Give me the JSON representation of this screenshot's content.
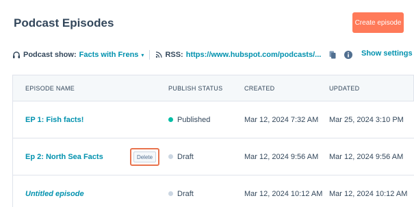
{
  "page_title": "Podcast Episodes",
  "create_button": "Create episode",
  "show_bar": {
    "show_label": "Podcast show:",
    "show_value": "Facts with Frens",
    "rss_label": "RSS:",
    "rss_url": "https://www.hubspot.com/podcasts/...",
    "show_settings": "Show settings"
  },
  "table": {
    "headers": [
      "EPISODE NAME",
      "PUBLISH STATUS",
      "CREATED",
      "UPDATED"
    ],
    "rows": [
      {
        "name": "EP 1: Fish facts!",
        "status": "Published",
        "created": "Mar 12, 2024 7:32 AM",
        "updated": "Mar 25, 2024 3:10 PM"
      },
      {
        "name": "Ep 2: North Sea Facts",
        "status": "Draft",
        "created": "Mar 12, 2024 9:56 AM",
        "updated": "Mar 12, 2024 9:56 AM",
        "action": "Delete"
      },
      {
        "name": "Untitled episode",
        "status": "Draft",
        "created": "Mar 12, 2024 10:12 AM",
        "updated": "Mar 12, 2024 10:12 AM"
      }
    ]
  },
  "colors": {
    "accent": "#ff7a59",
    "link": "#0091ae",
    "published": "#00bda5",
    "draft": "#cbd6e2",
    "highlight": "#e8724c"
  },
  "icons": [
    "headphones-icon",
    "chevron-down-icon",
    "rss-icon",
    "copy-icon",
    "info-icon"
  ]
}
